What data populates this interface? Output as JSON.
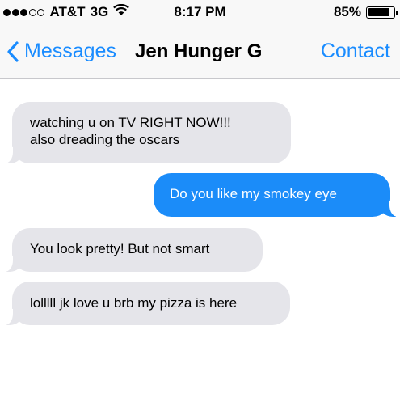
{
  "status_bar": {
    "carrier": "AT&T",
    "network": "3G",
    "time": "8:17 PM",
    "battery_percent": "85%",
    "battery_level": 0.85,
    "signal_bars_filled": 3,
    "signal_bars_total": 5,
    "icons": [
      "signal-dots-icon",
      "wifi-icon",
      "battery-icon"
    ]
  },
  "nav": {
    "back_label": "Messages",
    "title": "Jen Hunger G",
    "contact_label": "Contact"
  },
  "messages": [
    {
      "direction": "received",
      "text": "watching u on TV RIGHT NOW!!!\nalso dreading the oscars"
    },
    {
      "direction": "sent",
      "text": "Do you like my smokey eye"
    },
    {
      "direction": "received",
      "text": "You look pretty! But not smart"
    },
    {
      "direction": "received",
      "text": "lolllll jk love u brb my pizza is here"
    }
  ],
  "colors": {
    "accent": "#1a8cff",
    "sent_bubble": "#1b8cf9",
    "received_bubble": "#e5e5ea",
    "bar_background": "#f8f8f8"
  }
}
